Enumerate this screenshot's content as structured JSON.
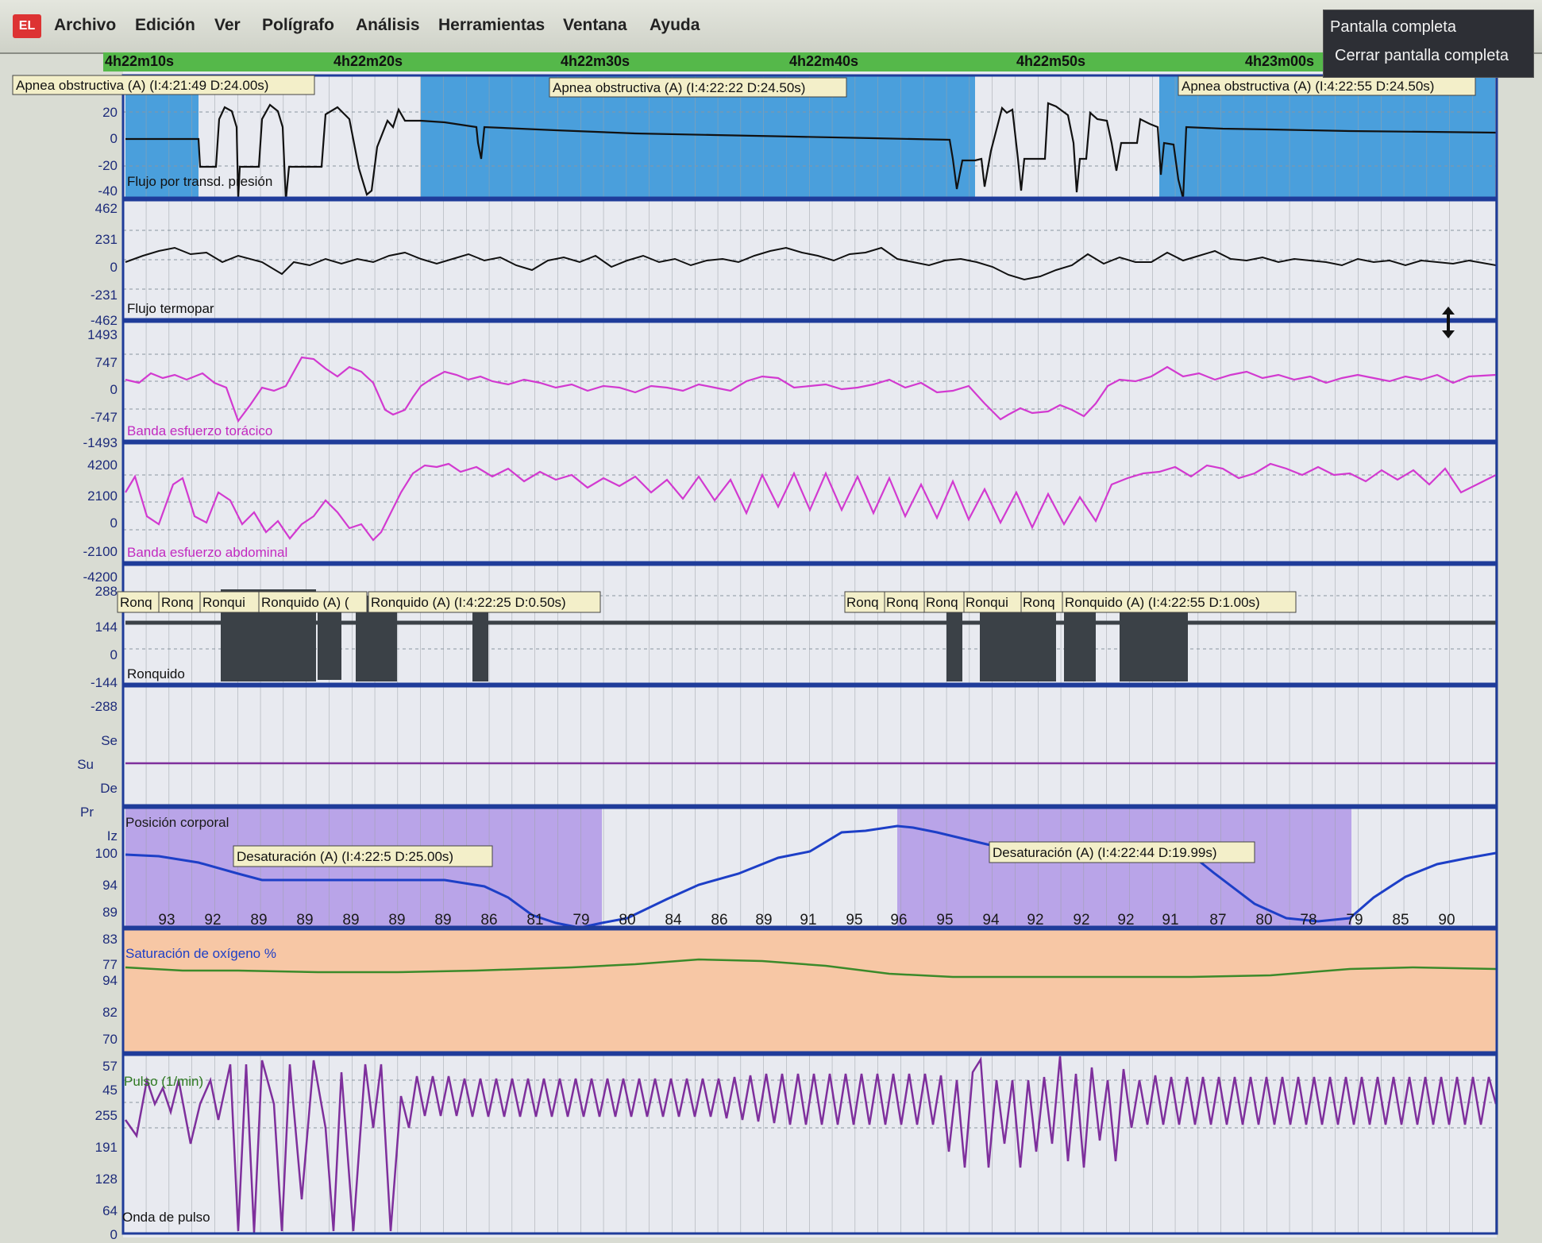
{
  "app": {
    "icon_text": "EL"
  },
  "menu": {
    "items": [
      "Archivo",
      "Edición",
      "Ver",
      "Polígrafo",
      "Análisis",
      "Herramientas",
      "Ventana",
      "Ayuda"
    ],
    "fullscreen": {
      "item1": "Pantalla completa",
      "item2": "Cerrar pantalla completa"
    }
  },
  "timeline": {
    "labels": [
      "4h22m10s",
      "4h22m20s",
      "4h22m30s",
      "4h22m40s",
      "4h22m50s",
      "4h23m00s"
    ]
  },
  "panels": {
    "flow_pressure": {
      "label": "Flujo por transd. presión",
      "y_ticks": [
        "20",
        "0",
        "-20",
        "-40"
      ],
      "events": [
        "Apnea obstructiva (A) (I:4:21:49 D:24.00s)",
        "Apnea obstructiva (A) (I:4:22:22 D:24.50s)",
        "Apnea obstructiva (A) (I:4:22:55 D:24.50s)"
      ]
    },
    "flow_thermo": {
      "label": "Flujo termopar",
      "y_ticks": [
        "462",
        "231",
        "0",
        "-231",
        "-462"
      ]
    },
    "thoracic": {
      "label": "Banda esfuerzo torácico",
      "y_ticks": [
        "1493",
        "747",
        "0",
        "-747",
        "-1493"
      ]
    },
    "abdominal": {
      "label": "Banda esfuerzo abdominal",
      "y_ticks": [
        "4200",
        "2100",
        "0",
        "-2100",
        "-4200"
      ]
    },
    "snore": {
      "label": "Ronquido",
      "y_ticks": [
        "288",
        "144",
        "0",
        "-144",
        "-288"
      ],
      "events": [
        "Ronq",
        "Ronq",
        "Ronqui",
        "Ronquido (A) (",
        "Ronquido (A) (I:4:22:25 D:0.50s)",
        "Ronq",
        "Ronq",
        "Ronq",
        "Ronqui",
        "Ronq",
        "Ronquido (A) (I:4:22:55 D:1.00s)"
      ]
    },
    "position": {
      "label": "Posición corporal",
      "y_ticks": [
        "Se",
        "Su",
        "De",
        "Pr",
        "Iz"
      ]
    },
    "spo2": {
      "label": "Saturación de oxígeno %",
      "y_ticks": [
        "100",
        "94",
        "89",
        "83",
        "77"
      ],
      "events": [
        "Desaturación (A) (I:4:22:5 D:25.00s)",
        "Desaturación (A) (I:4:22:44 D:19.99s)"
      ],
      "values": [
        "93",
        "92",
        "89",
        "89",
        "89",
        "89",
        "89",
        "86",
        "81",
        "79",
        "80",
        "84",
        "86",
        "89",
        "91",
        "95",
        "96",
        "95",
        "94",
        "92",
        "92",
        "92",
        "91",
        "87",
        "80",
        "78",
        "79",
        "85",
        "90"
      ]
    },
    "pulse": {
      "label": "Pulso (1/min)",
      "y_ticks": [
        "94",
        "82",
        "70",
        "57",
        "45"
      ]
    },
    "pleth": {
      "label": "Onda de pulso",
      "y_ticks": [
        "255",
        "191",
        "128",
        "64",
        "0"
      ]
    }
  },
  "colors": {
    "apnea": "#4a9fdc",
    "desat": "#b9a4e8",
    "pulse_bg": "#f7c7a5",
    "magenta": "#d23ad0",
    "spo2_line": "#1d3fc7",
    "pulse_line": "#3b8a2a",
    "pleth_line": "#7e2f9c",
    "timebar": "#55b84a"
  }
}
